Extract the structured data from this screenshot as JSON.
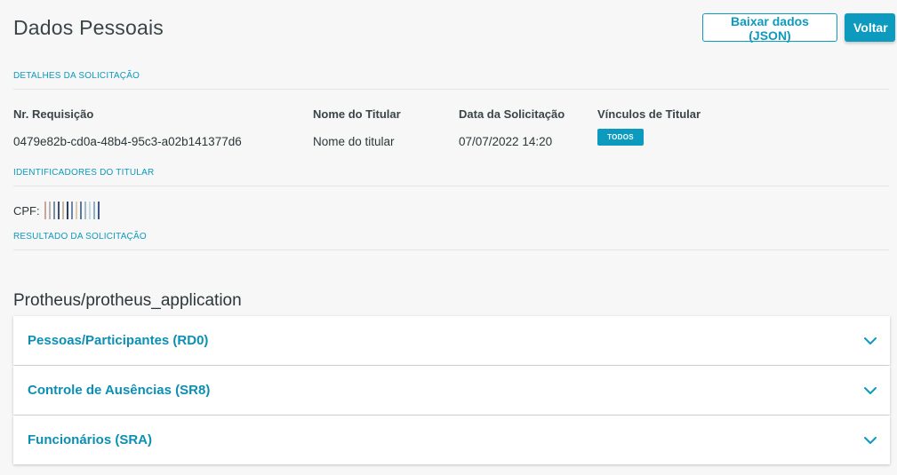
{
  "header": {
    "title": "Dados Pessoais",
    "download_label": "Baixar dados (JSON)",
    "back_label": "Voltar"
  },
  "sections": {
    "details": "DETALHES DA SOLICITAÇÃO",
    "identifiers": "IDENTIFICADORES DO TITULAR",
    "result": "RESULTADO DA SOLICITAÇÃO"
  },
  "details": {
    "request_number_label": "Nr. Requisição",
    "request_number": "0479e82b-cd0a-48b4-95c3-a02b141377d6",
    "holder_name_label": "Nome do Titular",
    "holder_name": "Nome do titular",
    "request_date_label": "Data da Solicitação",
    "request_date": "07/07/2022 14:20",
    "links_label": "Vínculos de Titular",
    "links_badge": "TODOS"
  },
  "identifiers": {
    "cpf_label": "CPF:"
  },
  "application": {
    "title": "Protheus/protheus_application",
    "tables": [
      {
        "label": "Pessoas/Participantes (RD0)"
      },
      {
        "label": "Controle de Ausências (SR8)"
      },
      {
        "label": "Funcionários (SRA)"
      }
    ]
  },
  "colors": {
    "accent": "#0c9abe",
    "text": "#2c3739",
    "background": "#f7f7f7"
  },
  "icons": {
    "accordion_toggle": "chevron-down-icon"
  }
}
